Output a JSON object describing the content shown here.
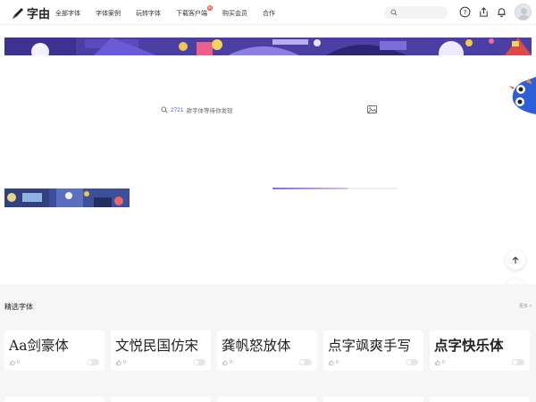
{
  "header": {
    "logo_text": "字由",
    "nav": [
      {
        "label": "全部字体"
      },
      {
        "label": "字体案例"
      },
      {
        "label": "玩转字体"
      },
      {
        "label": "下载客户端",
        "badge": "新"
      },
      {
        "label": "购买会员"
      },
      {
        "label": "合作"
      }
    ],
    "search_placeholder": "",
    "icons": [
      "help-icon",
      "upload-icon",
      "bell-icon",
      "avatar"
    ]
  },
  "hero": {
    "count": "2721",
    "search_text": "款字体等待你发现",
    "progress": 0.6
  },
  "featured": {
    "title": "精选字体",
    "more": "更多 >",
    "cards": [
      {
        "name": "Aa剑豪体",
        "likes": "0"
      },
      {
        "name": "文悦民国仿宋",
        "likes": "0"
      },
      {
        "name": "龚帆怒放体",
        "likes": "0"
      },
      {
        "name": "点字飒爽手写",
        "likes": "0"
      },
      {
        "name": "点字快乐体",
        "likes": "0"
      }
    ]
  },
  "colors": {
    "accent": "#4a5bd6",
    "banner": "#4b3fa3",
    "chat_button": "#3f63d9",
    "badge": "#e5533d"
  }
}
